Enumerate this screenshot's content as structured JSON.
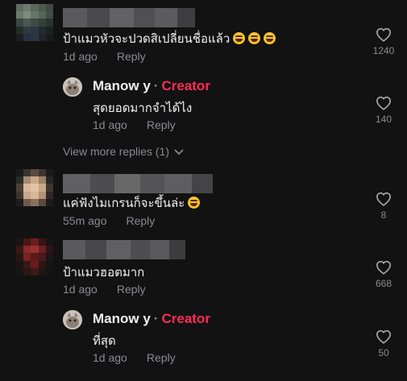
{
  "comments": [
    {
      "text": "ป้าแมวหัวจะปวดสิเปลี่ยนชื่อแล้ว",
      "emoji_count": 3,
      "time": "1d ago",
      "reply_label": "Reply",
      "likes": "1240"
    },
    {
      "text": "แค่ฟังไมเกรนก็จะขึ้นล่ะ",
      "emoji_count": 1,
      "time": "55m ago",
      "reply_label": "Reply",
      "likes": "8"
    },
    {
      "text": "ป้าแมวฮอตมาก",
      "emoji_count": 0,
      "time": "1d ago",
      "reply_label": "Reply",
      "likes": "668"
    }
  ],
  "replies": [
    {
      "author": "Manow y",
      "separator": "·",
      "badge": "Creator",
      "text": "สุดยอดมากจำได้ไง",
      "time": "1d ago",
      "reply_label": "Reply",
      "likes": "140"
    },
    {
      "author": "Manow y",
      "separator": "·",
      "badge": "Creator",
      "text": "ที่สุด",
      "time": "1d ago",
      "reply_label": "Reply",
      "likes": "50"
    }
  ],
  "view_more": "View more replies (1)",
  "colors": {
    "background": "#121212",
    "creator_badge": "#fe2c55",
    "muted": "#8a8b91"
  },
  "icons": [
    "heart-icon",
    "chevron-down-icon"
  ]
}
